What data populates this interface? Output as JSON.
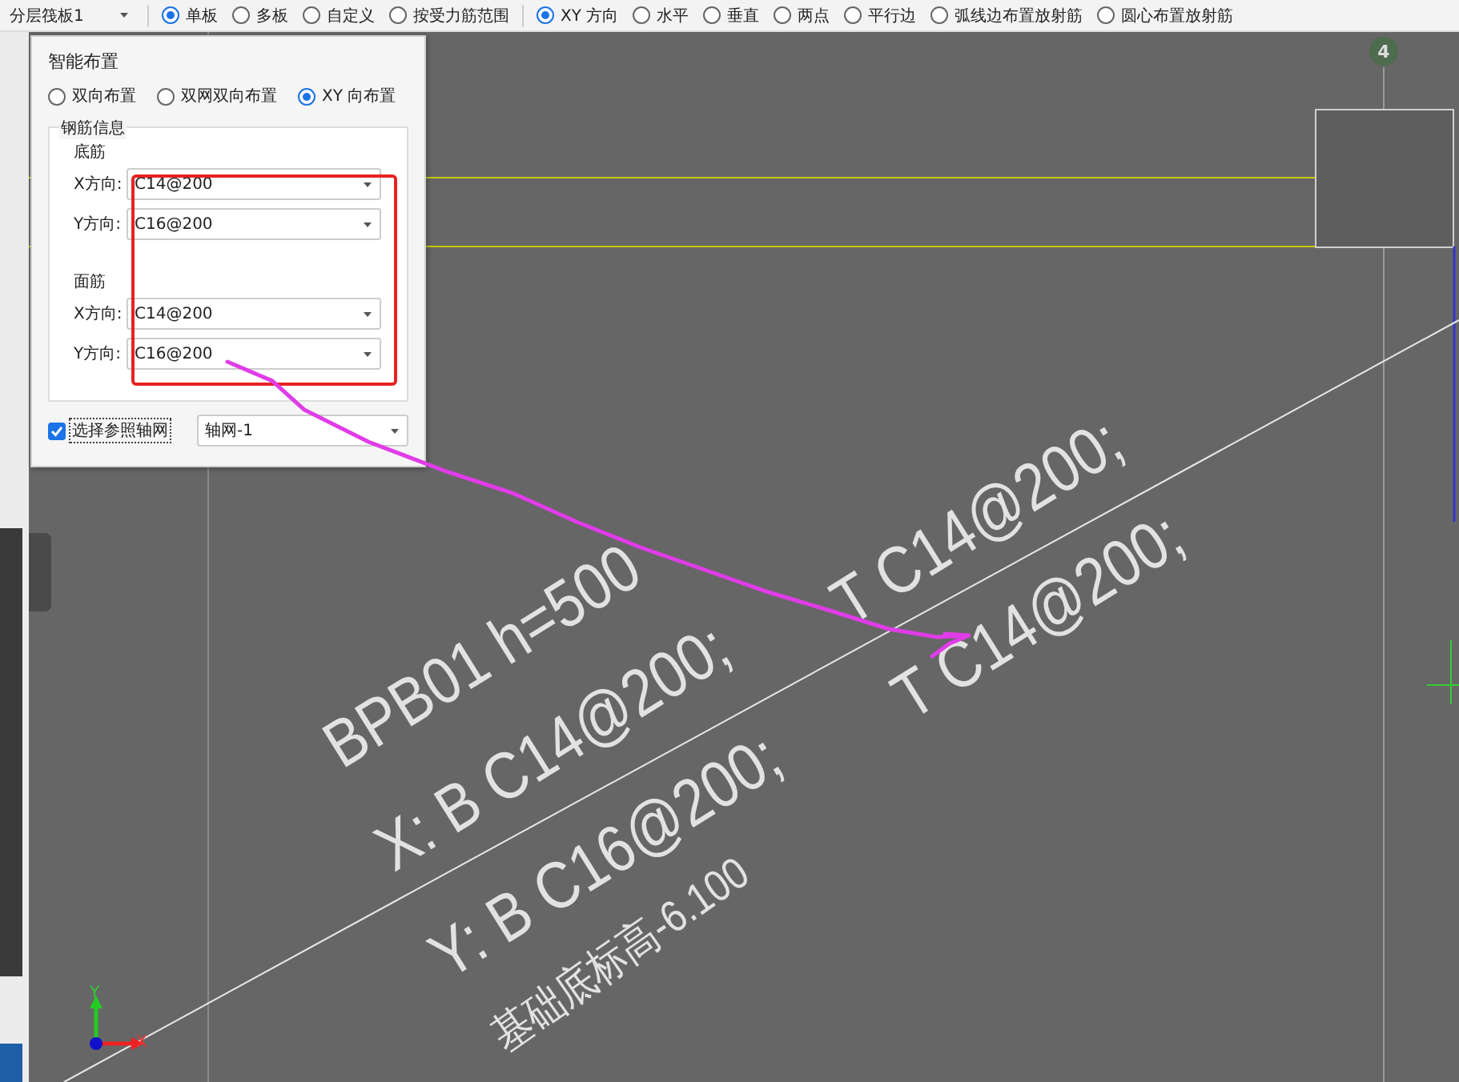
{
  "toolbar": {
    "layer_dropdown": "分层筏板1",
    "mode_options": [
      {
        "label": "单板",
        "selected": true
      },
      {
        "label": "多板",
        "selected": false
      },
      {
        "label": "自定义",
        "selected": false
      },
      {
        "label": "按受力筋范围",
        "selected": false
      }
    ],
    "direction_options": [
      {
        "label": "XY 方向",
        "selected": true
      },
      {
        "label": "水平",
        "selected": false
      },
      {
        "label": "垂直",
        "selected": false
      },
      {
        "label": "两点",
        "selected": false
      },
      {
        "label": "平行边",
        "selected": false
      },
      {
        "label": "弧线边布置放射筋",
        "selected": false
      },
      {
        "label": "圆心布置放射筋",
        "selected": false
      }
    ]
  },
  "dialog": {
    "title": "智能布置",
    "layout_options": [
      {
        "label": "双向布置",
        "selected": false
      },
      {
        "label": "双网双向布置",
        "selected": false
      },
      {
        "label": "XY 向布置",
        "selected": true
      }
    ],
    "group_title": "钢筋信息",
    "sections": [
      {
        "title": "底筋",
        "rows": [
          {
            "label": "X方向:",
            "value": "C14@200"
          },
          {
            "label": "Y方向:",
            "value": "C16@200"
          }
        ]
      },
      {
        "title": "面筋",
        "rows": [
          {
            "label": "X方向:",
            "value": "C14@200"
          },
          {
            "label": "Y方向:",
            "value": "C16@200"
          }
        ]
      }
    ],
    "reference_grid": {
      "label": "选择参照轴网",
      "checked": true,
      "value": "轴网-1"
    }
  },
  "canvas": {
    "axis_label": "4",
    "axis_x": "X",
    "axis_y": "Y",
    "drawing_texts": [
      "BPB01 h=500",
      "X: B C14@200;",
      "Y: B C16@200;",
      "基础底标高-6.100",
      "T C14@200;",
      "T C14@200;"
    ]
  }
}
